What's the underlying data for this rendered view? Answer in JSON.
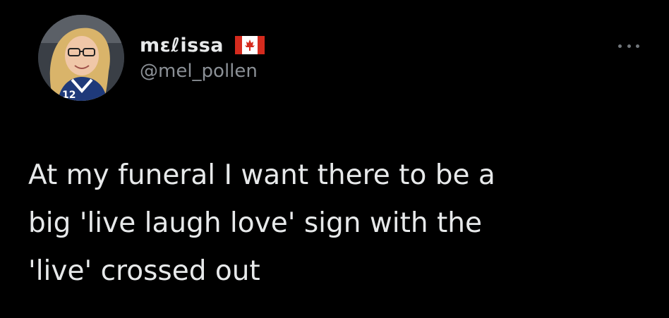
{
  "tweet": {
    "author": {
      "display_name": "mɛℓissa",
      "flag_icon": "canada-flag-icon",
      "handle": "@mel_pollen"
    },
    "more_icon": "more-options-icon",
    "text": "At my funeral I want there to be a\nbig 'live laugh love' sign with the\n'live' crossed out"
  },
  "colors": {
    "background": "#000000",
    "primary_text": "#e7e9ea",
    "secondary_text": "#8b9096",
    "flag_red": "#d52b1e"
  }
}
